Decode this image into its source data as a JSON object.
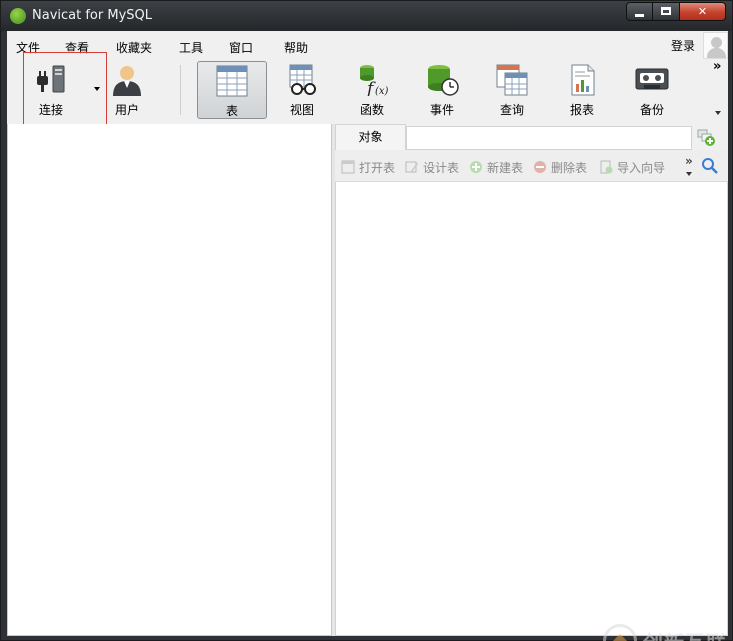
{
  "window": {
    "title": "Navicat for MySQL"
  },
  "menu": {
    "items": [
      "文件",
      "查看",
      "收藏夹",
      "工具",
      "窗口",
      "帮助"
    ],
    "login_label": "登录"
  },
  "toolbar": {
    "connect_label": "连接",
    "user_label": "用户",
    "table_label": "表",
    "view_label": "视图",
    "function_label": "函数",
    "event_label": "事件",
    "query_label": "查询",
    "report_label": "报表",
    "backup_label": "备份",
    "more_symbol": "»",
    "active_tool": "表"
  },
  "tabs": {
    "objects_label": "对象"
  },
  "object_toolbar": {
    "open_table": "打开表",
    "design_table": "设计表",
    "new_table": "新建表",
    "delete_table": "删除表",
    "import_wizard": "导入向导",
    "more_symbol": "»"
  },
  "watermark": {
    "text": "创新互联"
  },
  "colors": {
    "highlight_border": "#d7403a",
    "titlebar": "#2e3236",
    "close_button": "#c5422d",
    "disabled_text": "#8a8a8a"
  }
}
